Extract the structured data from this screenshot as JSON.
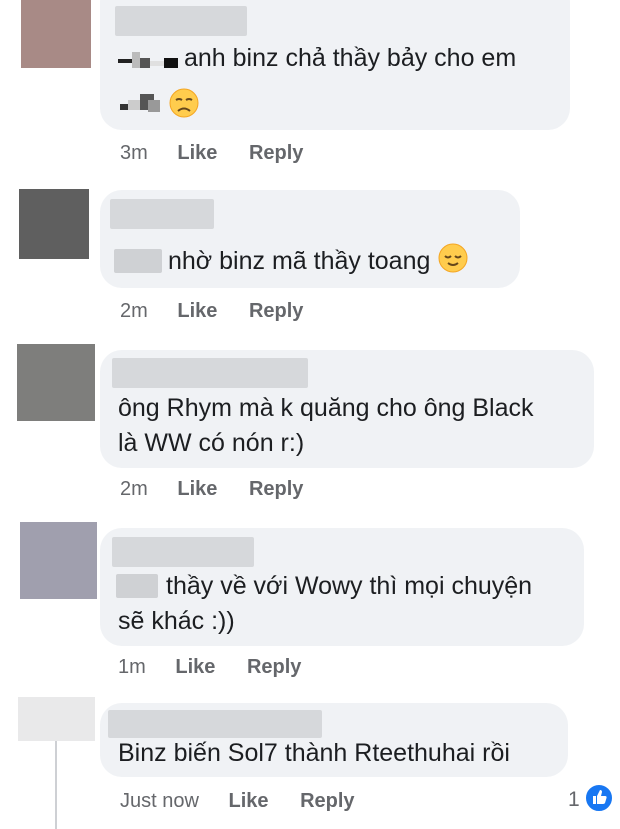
{
  "comments": [
    {
      "text_line1": "anh binz chả thầy bảy cho em",
      "text_line2": "",
      "time": "3m",
      "like_label": "Like",
      "reply_label": "Reply",
      "avatar_color": "#a88a86"
    },
    {
      "text_line1": "nhờ binz mã thầy toang",
      "time": "2m",
      "like_label": "Like",
      "reply_label": "Reply",
      "avatar_color": "#5f5f5f"
    },
    {
      "text_line1": "ông Rhym mà k quăng cho ông Black",
      "text_line2": "là WW có nón r:)",
      "time": "2m",
      "like_label": "Like",
      "reply_label": "Reply",
      "avatar_color": "#7e7e7c"
    },
    {
      "text_line1": "thầy về với Wowy thì mọi chuyện",
      "text_line2": "sẽ khác :))",
      "time": "1m",
      "like_label": "Like",
      "reply_label": "Reply",
      "avatar_color": "#a09fae"
    },
    {
      "text_line1": "Binz biến Sol7 thành Rteethuhai rồi",
      "time": "Just now",
      "like_label": "Like",
      "reply_label": "Reply",
      "reaction_count": "1",
      "avatar_color": "#e9e9ea"
    }
  ],
  "icons": {
    "sad_emoji": "sad-face-emoji",
    "relieved_emoji": "relieved-face-emoji",
    "like_reaction": "thumbs-up-icon"
  },
  "colors": {
    "bubble": "#f0f2f5",
    "meta_text": "#65676b",
    "like_blue": "#1877f2"
  }
}
